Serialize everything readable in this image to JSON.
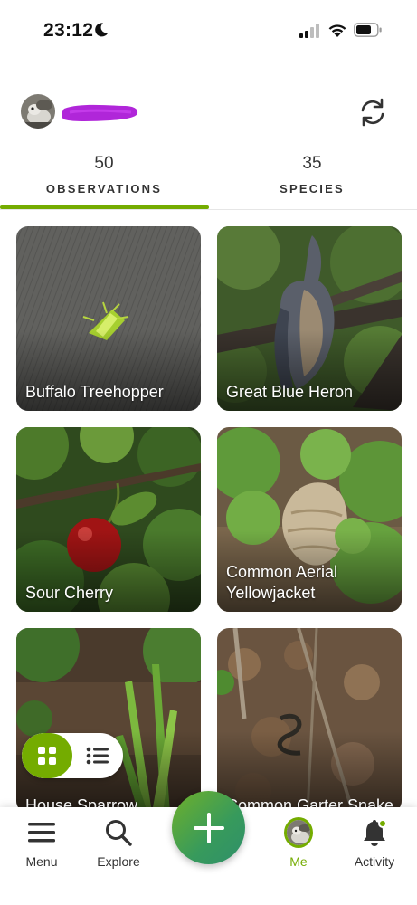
{
  "status_bar": {
    "time": "23:12"
  },
  "header": {
    "username_redacted": true
  },
  "tabs": [
    {
      "count": "50",
      "label": "OBSERVATIONS",
      "active": true
    },
    {
      "count": "35",
      "label": "SPECIES",
      "active": false
    }
  ],
  "observations": [
    {
      "name": "Buffalo Treehopper"
    },
    {
      "name": "Great Blue Heron"
    },
    {
      "name": "Sour Cherry"
    },
    {
      "name": "Common Aerial Yellowjacket"
    },
    {
      "name": "House Sparrow"
    },
    {
      "name": "Common Garter Snake"
    }
  ],
  "view_toggle": {
    "active": "grid",
    "options": [
      "grid-icon",
      "list-icon"
    ]
  },
  "bottom_nav": {
    "menu_label": "Menu",
    "explore_label": "Explore",
    "me_label": "Me",
    "activity_label": "Activity",
    "add_icon": "plus-icon"
  },
  "colors": {
    "accent": "#74ac00",
    "add_button": "#379a5c"
  }
}
